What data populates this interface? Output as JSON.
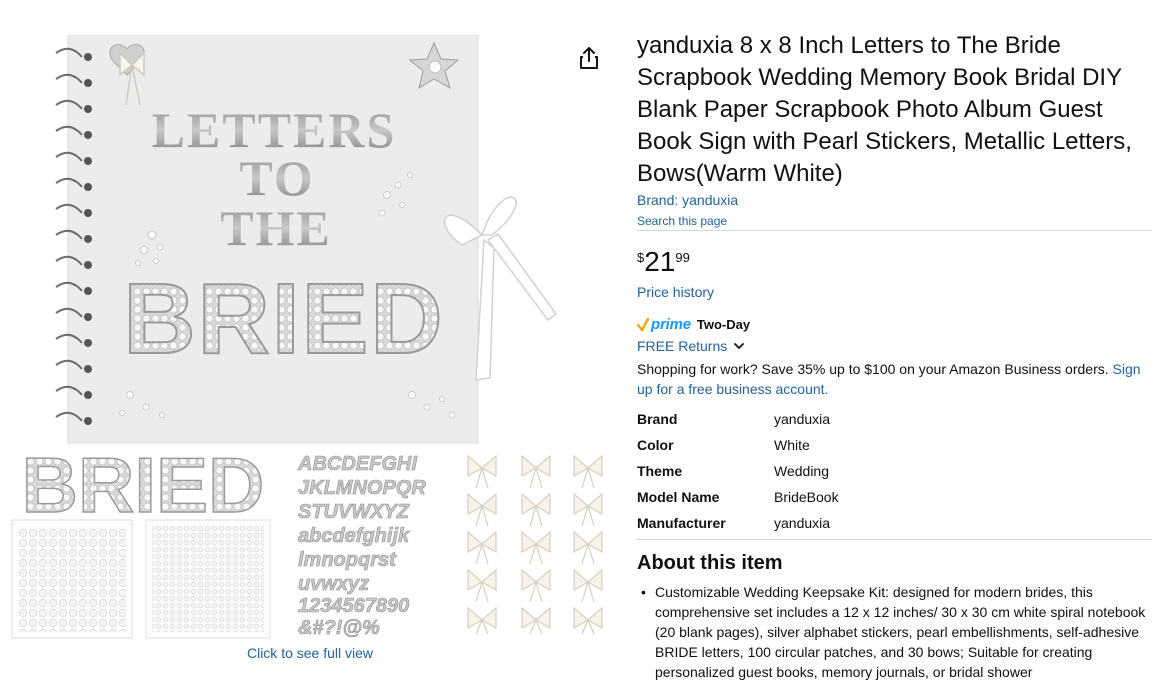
{
  "title": "yanduxia 8 x 8 Inch Letters to The Bride Scrapbook Wedding Memory Book Bridal DIY Blank Paper Scrapbook Photo Album Guest Book Sign with Pearl Stickers, Metallic Letters, Bows(Warm White)",
  "brand_link": "Brand: yanduxia",
  "search_page_link": "Search this page",
  "price": {
    "symbol": "$",
    "whole": "21",
    "fraction": "99"
  },
  "price_history": "Price history",
  "prime": {
    "word": "prime",
    "label": "Two-Day"
  },
  "free_returns": "FREE Returns",
  "business": {
    "text": "Shopping for work? Save 35% up to $100 on your Amazon Business orders. ",
    "link": "Sign up for a free business account."
  },
  "specs": [
    {
      "key": "Brand",
      "value": "yanduxia"
    },
    {
      "key": "Color",
      "value": "White"
    },
    {
      "key": "Theme",
      "value": "Wedding"
    },
    {
      "key": "Model Name",
      "value": "BrideBook"
    },
    {
      "key": "Manufacturer",
      "value": "yanduxia"
    }
  ],
  "about": {
    "heading": "About this item",
    "items": [
      "Customizable Wedding Keepsake Kit: designed for modern brides, this comprehensive set includes a 12 x 12 inches/ 30 x 30 cm white spiral notebook (20 blank pages), silver alphabet stickers, pearl embellishments, self-adhesive BRIDE letters, 100 circular patches, and 30 bows; Suitable for creating personalized guest books, memory journals, or bridal shower"
    ]
  },
  "image": {
    "cover_line1": "LETTERS",
    "cover_line2": "TO",
    "cover_line3": "THE",
    "cover_bride": "BRIED",
    "swatch_bride": "BRIED",
    "alphabet": [
      "ABCDEFGHI",
      "JKLMNOPQR",
      "STUVWXYZ",
      "abcdefghijk",
      "lmnopqrst",
      "uvwxyz",
      "1234567890",
      "&#?!@%"
    ],
    "full_view_link": "Click to see full view"
  },
  "colors": {
    "link": "#2162a1",
    "prime": "#1399ff",
    "prime_check": "#f7a600",
    "text": "#0f1111",
    "divider": "#d5d9d9"
  }
}
